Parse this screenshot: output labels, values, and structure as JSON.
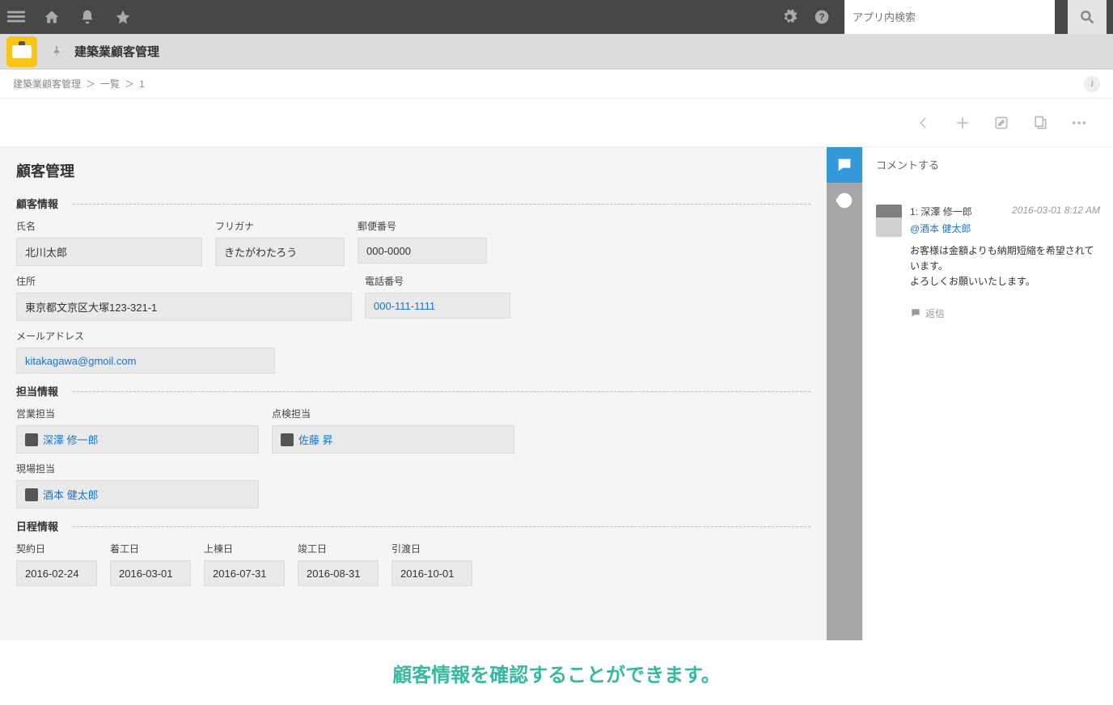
{
  "topbar": {
    "search_placeholder": "アプリ内検索"
  },
  "app": {
    "title": "建築業顧客管理"
  },
  "breadcrumb": {
    "a": "建築業顧客管理",
    "b": "一覧",
    "c": "1"
  },
  "form": {
    "page_title": "顧客管理",
    "sec_customer": "顧客情報",
    "sec_assignee": "担当情報",
    "sec_schedule": "日程情報",
    "labels": {
      "name": "氏名",
      "kana": "フリガナ",
      "postal": "郵便番号",
      "address": "住所",
      "phone": "電話番号",
      "email": "メールアドレス",
      "sales_rep": "営業担当",
      "inspect_rep": "点検担当",
      "site_rep": "現場担当",
      "d_contract": "契約日",
      "d_start": "着工日",
      "d_ridge": "上棟日",
      "d_complete": "竣工日",
      "d_handover": "引渡日"
    },
    "values": {
      "name": "北川太郎",
      "kana": "きたがわたろう",
      "postal": "000-0000",
      "address": "東京都文京区大塚123-321-1",
      "phone": "000-111-1111",
      "email": "kitakagawa@gmoil.com",
      "sales_rep": "深澤 修一郎",
      "inspect_rep": "佐藤 昇",
      "site_rep": "酒本 健太郎",
      "d_contract": "2016-02-24",
      "d_start": "2016-03-01",
      "d_ridge": "2016-07-31",
      "d_complete": "2016-08-31",
      "d_handover": "2016-10-01"
    }
  },
  "comments": {
    "compose_label": "コメントする",
    "reply_label": "返信",
    "item": {
      "index": "1:",
      "author": "深澤 修一郎",
      "timestamp": "2016-03-01 8:12 AM",
      "mention": "@酒本 健太郎",
      "body1": "お客様は金額よりも納期短縮を希望されています。",
      "body2": "よろしくお願いいたします。"
    }
  },
  "caption": "顧客情報を確認することができます。"
}
